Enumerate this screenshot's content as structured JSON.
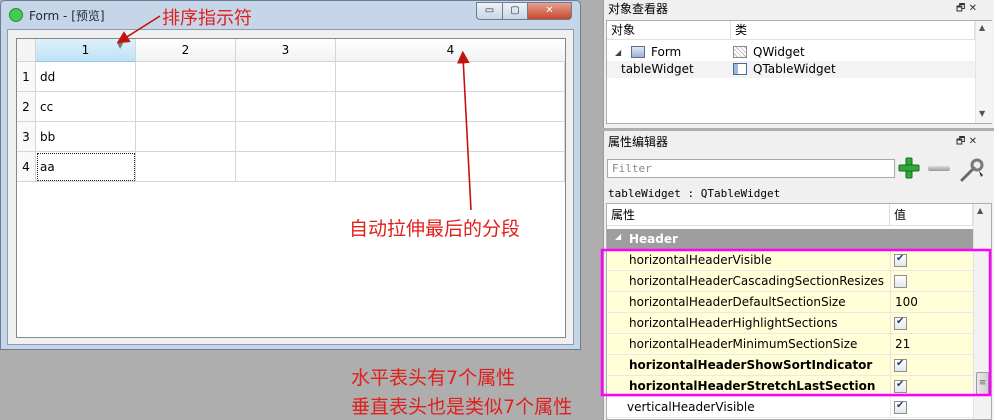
{
  "window": {
    "title": "Form - [预览]",
    "buttons": {
      "minimize": "▭",
      "maximize": "▢",
      "close": "✕"
    }
  },
  "table": {
    "columns": [
      "1",
      "2",
      "3",
      "4"
    ],
    "rows": [
      {
        "header": "1",
        "cells": [
          "dd",
          "",
          "",
          ""
        ]
      },
      {
        "header": "2",
        "cells": [
          "cc",
          "",
          "",
          ""
        ]
      },
      {
        "header": "3",
        "cells": [
          "bb",
          "",
          "",
          ""
        ]
      },
      {
        "header": "4",
        "cells": [
          "aa",
          "",
          "",
          ""
        ]
      }
    ],
    "sort_indicator": "▼"
  },
  "object_inspector": {
    "title": "对象查看器",
    "col_object": "对象",
    "col_class": "类",
    "items": [
      {
        "object": "Form",
        "class": "QWidget",
        "expander": "◢"
      },
      {
        "object": "tableWidget",
        "class": "QTableWidget"
      }
    ],
    "dock_buttons": "🗗 ✕"
  },
  "property_editor": {
    "title": "属性编辑器",
    "dock_buttons": "🗗 ✕",
    "filter_placeholder": "Filter",
    "object_class_line": "tableWidget : QTableWidget",
    "col_property": "属性",
    "col_value": "值",
    "group": {
      "label": "Header",
      "expander": "◢"
    },
    "properties": [
      {
        "name": "horizontalHeaderVisible",
        "checked": true
      },
      {
        "name": "horizontalHeaderCascadingSectionResizes",
        "checked": false
      },
      {
        "name": "horizontalHeaderDefaultSectionSize",
        "value": "100"
      },
      {
        "name": "horizontalHeaderHighlightSections",
        "checked": true
      },
      {
        "name": "horizontalHeaderMinimumSectionSize",
        "value": "21"
      },
      {
        "name": "horizontalHeaderShowSortIndicator",
        "checked": true,
        "bold": true
      },
      {
        "name": "horizontalHeaderStretchLastSection",
        "checked": true,
        "bold": true
      },
      {
        "name": "verticalHeaderVisible",
        "checked": true
      }
    ]
  },
  "annotations": {
    "sort_indicator": "排序指示符",
    "stretch_last": "自动拉伸最后的分段",
    "note_line1": "水平表头有7个属性",
    "note_line2": "垂直表头也是类似7个属性"
  },
  "colors": {
    "annotation": "#e0201c",
    "highlight_border": "#ff00ff",
    "group_header": "#9e9e9e",
    "property_row": "#fffed6"
  }
}
